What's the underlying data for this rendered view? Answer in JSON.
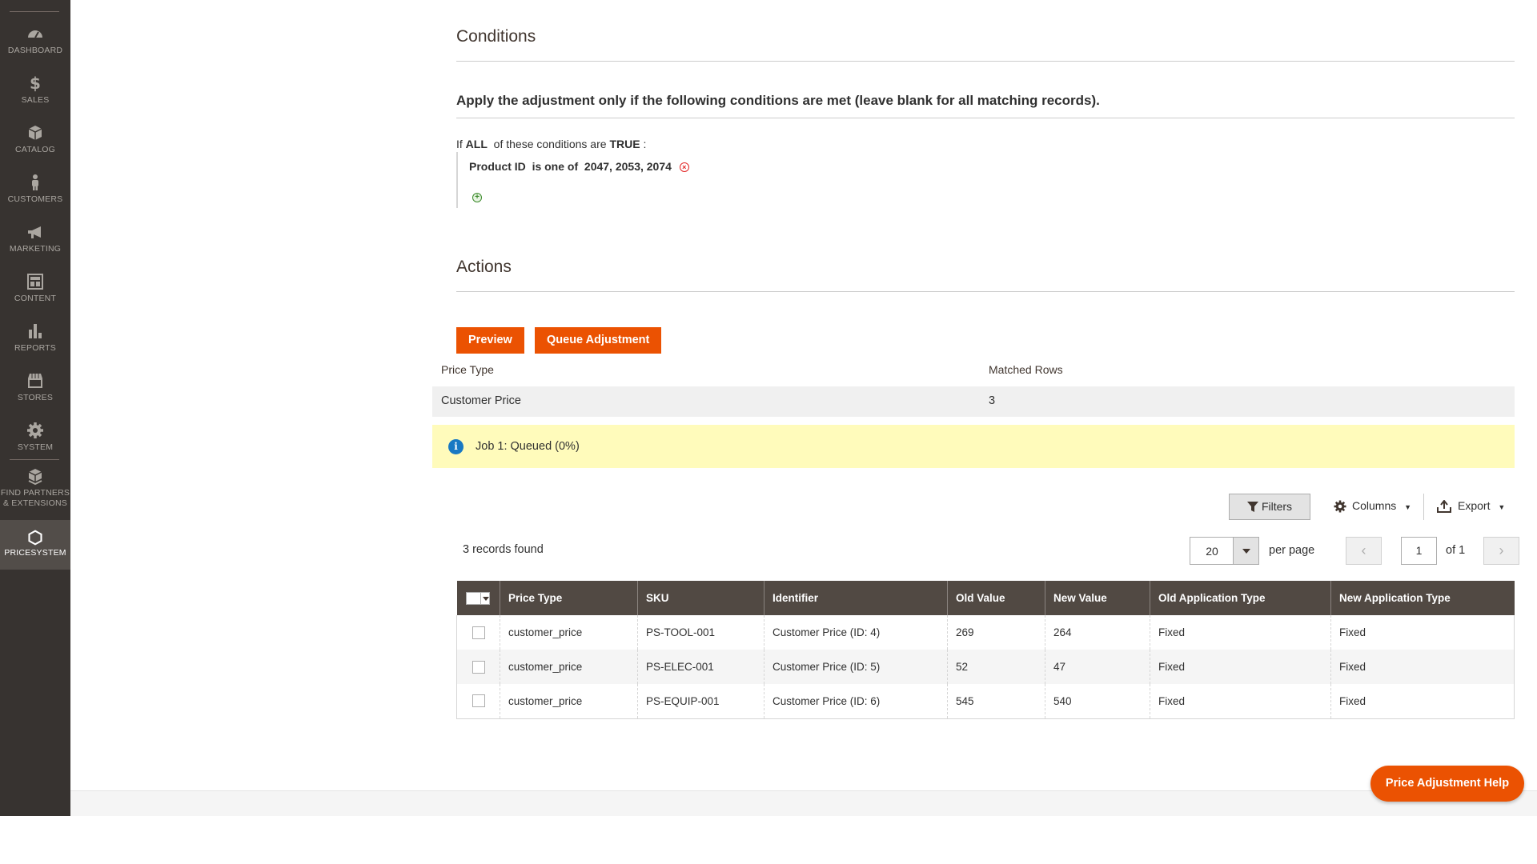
{
  "sidebar": {
    "items": [
      {
        "label": "DASHBOARD",
        "icon": "dashboard-icon"
      },
      {
        "label": "SALES",
        "icon": "dollar-icon"
      },
      {
        "label": "CATALOG",
        "icon": "cube-icon"
      },
      {
        "label": "CUSTOMERS",
        "icon": "person-icon"
      },
      {
        "label": "MARKETING",
        "icon": "megaphone-icon"
      },
      {
        "label": "CONTENT",
        "icon": "layout-icon"
      },
      {
        "label": "REPORTS",
        "icon": "bar-chart-icon"
      },
      {
        "label": "STORES",
        "icon": "store-icon"
      },
      {
        "label": "SYSTEM",
        "icon": "gear-icon"
      },
      {
        "label_line1": "FIND PARTNERS",
        "label_line2": "& EXTENSIONS",
        "icon": "boxes-icon"
      },
      {
        "label": "PRICESYSTEM",
        "icon": "hexagon-icon",
        "active": true
      }
    ]
  },
  "conditions": {
    "title": "Conditions",
    "heading": "Apply the adjustment only if the following conditions are met (leave blank for all matching records).",
    "if_prefix": "If",
    "aggregator": "ALL",
    "middle": "of these conditions are",
    "value": "TRUE",
    "suffix": ":",
    "rule": {
      "attribute": "Product ID",
      "operator": "is one of",
      "value": "2047, 2053, 2074"
    }
  },
  "actions": {
    "title": "Actions",
    "preview_label": "Preview",
    "queue_label": "Queue Adjustment"
  },
  "summary": {
    "col_price_type": "Price Type",
    "col_matched_rows": "Matched Rows",
    "price_type": "Customer Price",
    "matched_rows": "3"
  },
  "notice": {
    "text": "Job 1: Queued (0%)"
  },
  "toolbar": {
    "filters_label": "Filters",
    "columns_label": "Columns",
    "export_label": "Export",
    "records_found": "3 records found",
    "per_page_value": "20",
    "per_page_label": "per page",
    "current_page": "1",
    "page_of": "of 1"
  },
  "grid": {
    "columns": [
      "Price Type",
      "SKU",
      "Identifier",
      "Old Value",
      "New Value",
      "Old Application Type",
      "New Application Type"
    ],
    "rows": [
      {
        "price_type": "customer_price",
        "sku": "PS-TOOL-001",
        "identifier": "Customer Price (ID: 4)",
        "old_value": "269",
        "new_value": "264",
        "old_app_type": "Fixed",
        "new_app_type": "Fixed"
      },
      {
        "price_type": "customer_price",
        "sku": "PS-ELEC-001",
        "identifier": "Customer Price (ID: 5)",
        "old_value": "52",
        "new_value": "47",
        "old_app_type": "Fixed",
        "new_app_type": "Fixed"
      },
      {
        "price_type": "customer_price",
        "sku": "PS-EQUIP-001",
        "identifier": "Customer Price (ID: 6)",
        "old_value": "545",
        "new_value": "540",
        "old_app_type": "Fixed",
        "new_app_type": "Fixed"
      }
    ]
  },
  "help_button_label": "Price Adjustment Help",
  "colors": {
    "accent": "#eb5202",
    "sidebar": "#373330",
    "grid_header": "#514943",
    "notice_bg": "#fffbbb",
    "info": "#1979c3"
  }
}
